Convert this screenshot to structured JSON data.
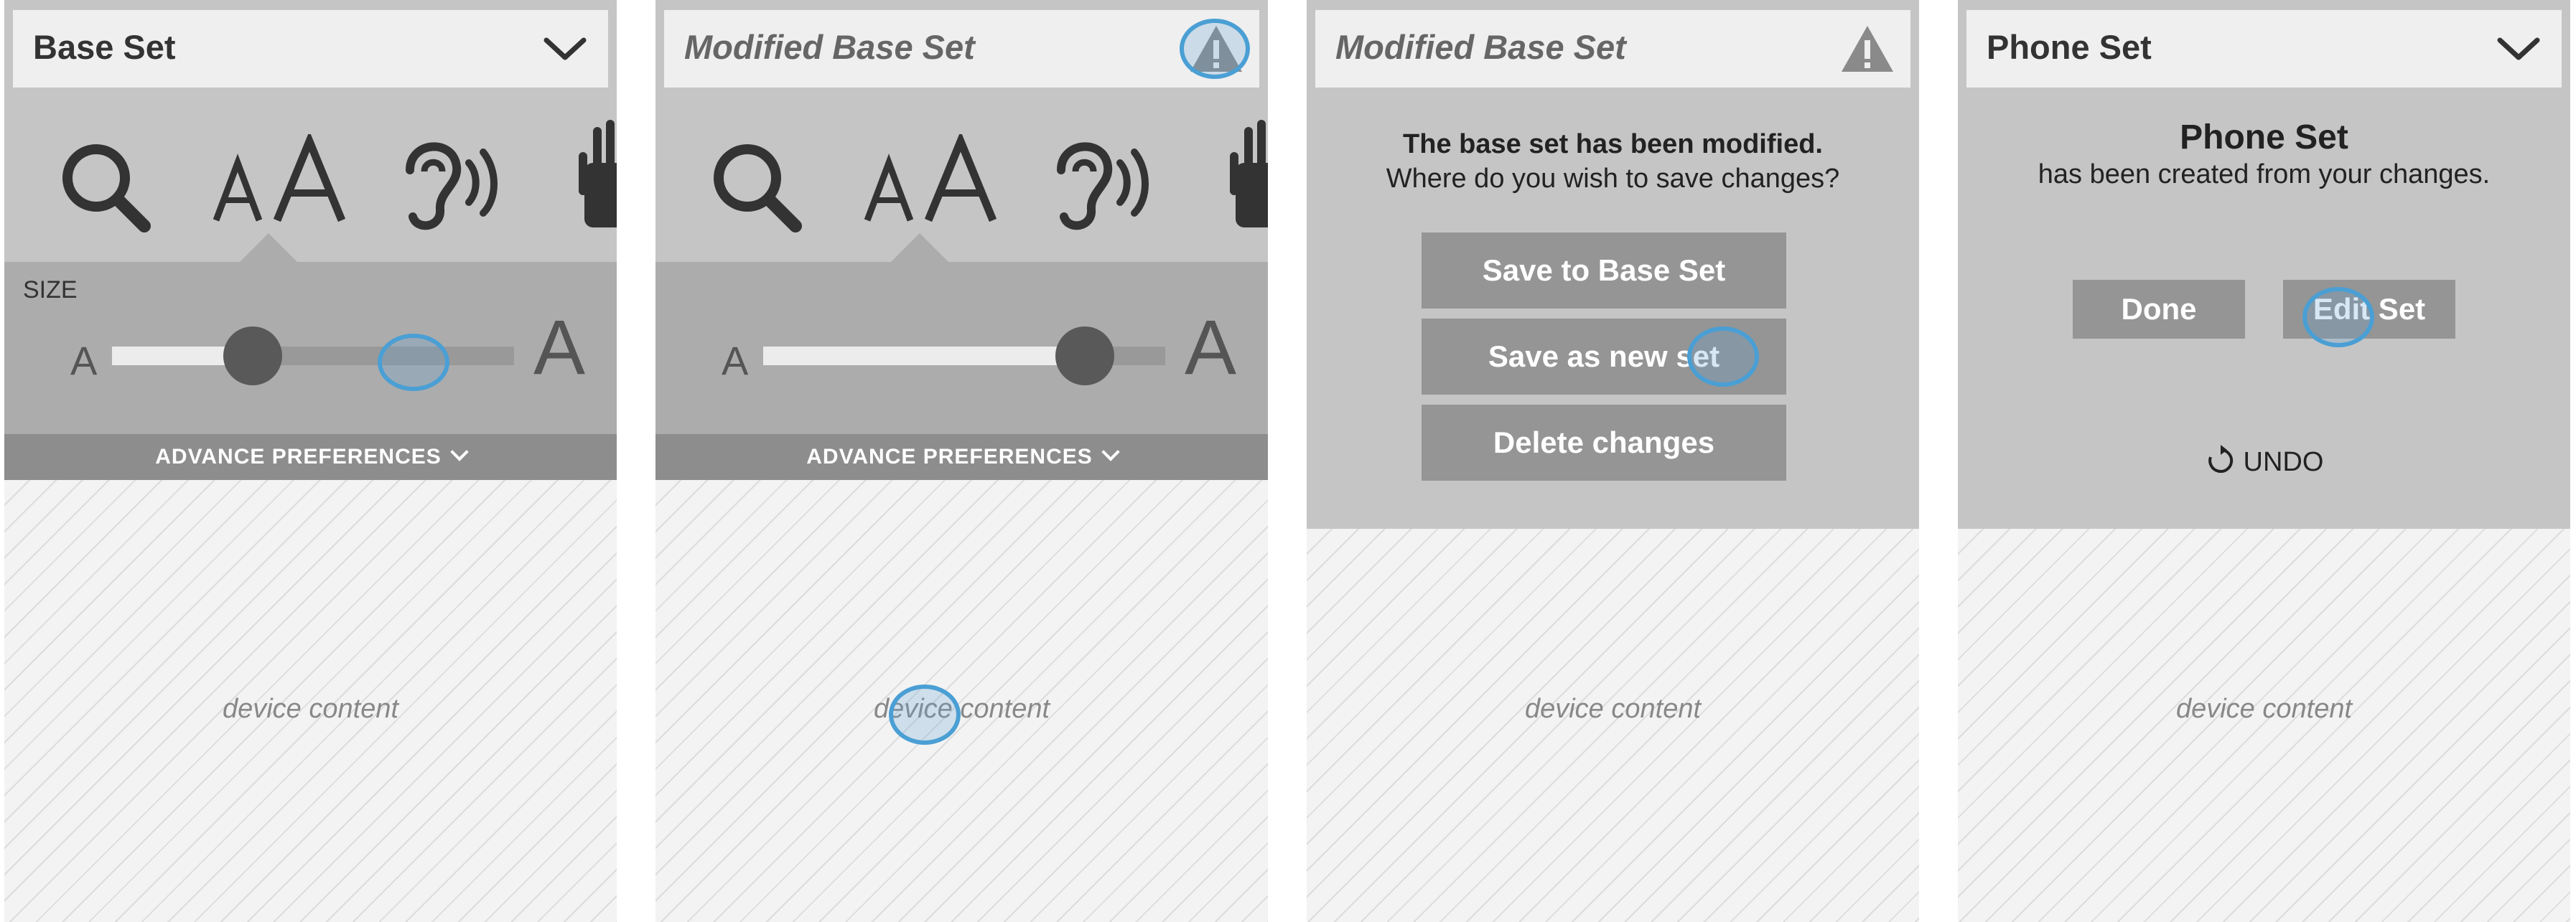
{
  "colors": {
    "accent_circle": "#4a9fd4",
    "header_bg": "#efefef",
    "panel_bg": "#c5c5c5",
    "button_bg": "#959595"
  },
  "panel1": {
    "header_title": "Base Set",
    "header_icon": "chevron-down-icon",
    "tool_icons": [
      "search-icon",
      "text-size-icon",
      "hearing-icon",
      "hand-icon"
    ],
    "size_label": "SIZE",
    "slider_min_label": "A",
    "slider_max_label": "A",
    "slider_value": 0.35,
    "advance_label": "ADVANCE PREFERENCES",
    "content_label": "device content"
  },
  "panel2": {
    "header_title": "Modified Base Set",
    "header_icon": "warning-icon",
    "tool_icons": [
      "search-icon",
      "text-size-icon",
      "hearing-icon",
      "hand-icon"
    ],
    "slider_min_label": "A",
    "slider_max_label": "A",
    "slider_value": 0.8,
    "advance_label": "ADVANCE PREFERENCES",
    "content_label": "device content"
  },
  "panel3": {
    "header_title": "Modified Base Set",
    "header_icon": "warning-icon",
    "message_bold": "The base set has been modified.",
    "message": "Where do you wish to save changes?",
    "buttons": [
      "Save to Base Set",
      "Save as new set",
      "Delete changes"
    ],
    "content_label": "device content"
  },
  "panel4": {
    "header_title": "Phone Set",
    "header_icon": "chevron-down-icon",
    "message_bold": "Phone Set",
    "message": "has been created from your changes.",
    "done_label": "Done",
    "edit_label": "Edit Set",
    "undo_label": "UNDO",
    "content_label": "device content"
  }
}
